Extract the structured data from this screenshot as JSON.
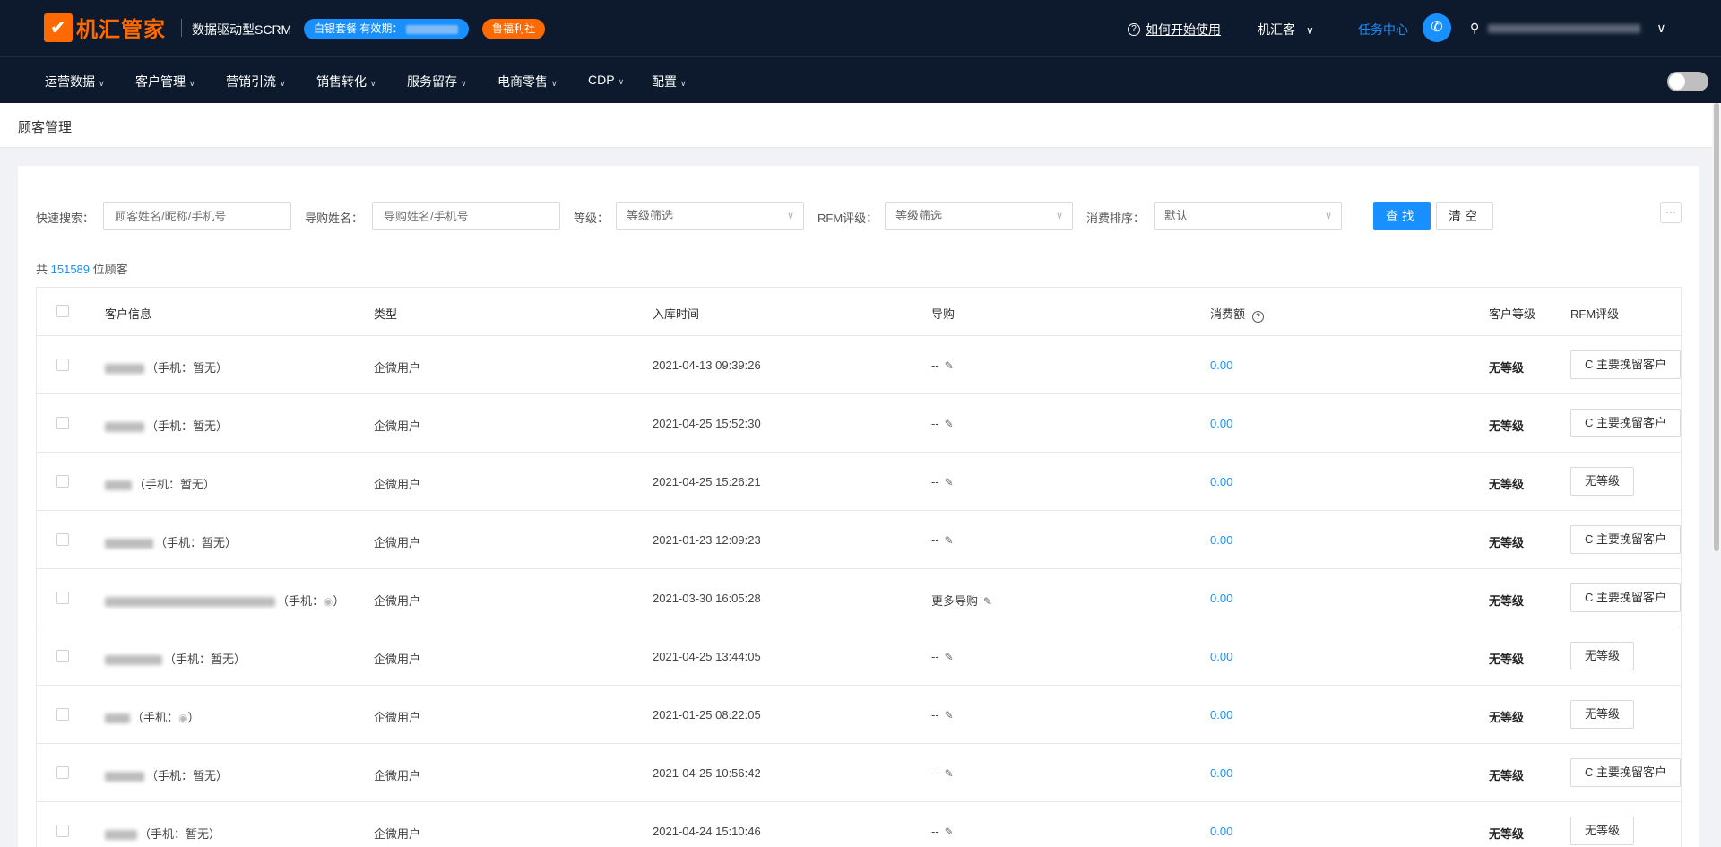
{
  "header": {
    "logo_text": "机汇管家",
    "logo_mark": "✔",
    "product_name": "数据驱动型SCRM",
    "plan_label": "白银套餐 有效期：",
    "welfare_label": "鲁福利社",
    "help_label": "如何开始使用",
    "org_label": "机汇客",
    "task_center_label": "任务中心"
  },
  "nav": {
    "items": [
      "运营数据",
      "客户管理",
      "营销引流",
      "销售转化",
      "服务留存",
      "电商零售",
      "CDP",
      "配置"
    ]
  },
  "breadcrumb": {
    "title": "顾客管理"
  },
  "filters": {
    "quick_search_label": "快速搜索：",
    "quick_search_placeholder": "顾客姓名/昵称/手机号",
    "guide_label": "导购姓名：",
    "guide_placeholder": "导购姓名/手机号",
    "level_label": "等级：",
    "level_value": "等级筛选",
    "rfm_label": "RFM评级：",
    "rfm_value": "等级筛选",
    "sort_label": "消费排序：",
    "sort_value": "默认",
    "search_button": "查找",
    "clear_button": "清空",
    "more_button": "···"
  },
  "summary": {
    "prefix": "共",
    "count": "151589",
    "suffix": "位顾客"
  },
  "table": {
    "columns": [
      "客户信息",
      "类型",
      "入库时间",
      "导购",
      "消费额",
      "客户等级",
      "RFM评级"
    ],
    "rows": [
      {
        "phone_text": "（手机：暂无）",
        "type": "企微用户",
        "time": "2021-04-13 09:39:26",
        "guide": "--",
        "amount": "0.00",
        "level": "无等级",
        "rfm": "C 主要挽留客户"
      },
      {
        "phone_text": "（手机：暂无）",
        "type": "企微用户",
        "time": "2021-04-25 15:52:30",
        "guide": "--",
        "amount": "0.00",
        "level": "无等级",
        "rfm": "C 主要挽留客户"
      },
      {
        "phone_text": "（手机：暂无）",
        "type": "企微用户",
        "time": "2021-04-25 15:26:21",
        "guide": "--",
        "amount": "0.00",
        "level": "无等级",
        "rfm": "无等级"
      },
      {
        "phone_text": "（手机：暂无）",
        "type": "企微用户",
        "time": "2021-01-23 12:09:23",
        "guide": "--",
        "amount": "0.00",
        "level": "无等级",
        "rfm": "C 主要挽留客户"
      },
      {
        "phone_text": "（手机：",
        "phone_suffix": "）",
        "type": "企微用户",
        "time": "2021-03-30 16:05:28",
        "guide": "更多导购",
        "amount": "0.00",
        "level": "无等级",
        "rfm": "C 主要挽留客户"
      },
      {
        "phone_text": "（手机：暂无）",
        "type": "企微用户",
        "time": "2021-04-25 13:44:05",
        "guide": "--",
        "amount": "0.00",
        "level": "无等级",
        "rfm": "无等级"
      },
      {
        "phone_text": "（手机：",
        "phone_suffix": "）",
        "type": "企微用户",
        "time": "2021-01-25 08:22:05",
        "guide": "--",
        "amount": "0.00",
        "level": "无等级",
        "rfm": "无等级"
      },
      {
        "phone_text": "（手机：暂无）",
        "type": "企微用户",
        "time": "2021-04-25 10:56:42",
        "guide": "--",
        "amount": "0.00",
        "level": "无等级",
        "rfm": "C 主要挽留客户"
      },
      {
        "phone_text": "（手机：暂无）",
        "type": "企微用户",
        "time": "2021-04-24 15:10:46",
        "guide": "--",
        "amount": "0.00",
        "level": "无等级",
        "rfm": "无等级"
      }
    ]
  },
  "colors": {
    "brand": "#ff6a00",
    "accent": "#1890ff",
    "nav_bg": "#0d1a2e"
  }
}
